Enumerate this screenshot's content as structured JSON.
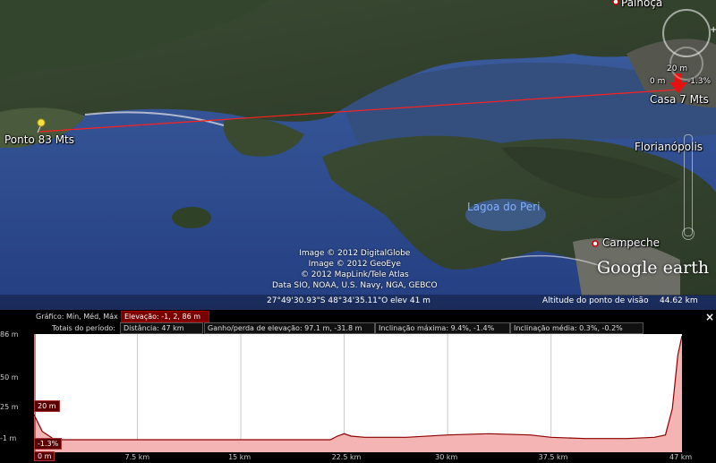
{
  "map": {
    "labels": {
      "palhoca": "Palhoça",
      "start_point": "Ponto 83 Mts",
      "end_point": "Casa 7 Mts",
      "florianopolis": "Florianópolis",
      "lagoa": "Lagoa do Peri",
      "campeche": "Campeche",
      "marker_elev": "20 m",
      "marker_left": "0 m",
      "marker_right": "-1.3%"
    },
    "credits": {
      "line1": "Image © 2012 DigitalGlobe",
      "line2": "Image © 2012 GeoEye",
      "line3": "© 2012 MapLink/Tele Atlas",
      "line4": "Data SIO, NOAA, U.S. Navy, NGA, GEBCO"
    },
    "logo": "Google earth",
    "status": {
      "coords": "27°49'30.93\"S   48°34'35.11\"O elev    41 m",
      "eye_alt_label": "Altitude do ponto de visão",
      "eye_alt_value": "44.62 km"
    }
  },
  "profile": {
    "graph_label": "Gráfico: Mín, Méd, Máx",
    "totals_label": "Totais do período:",
    "elevation": "Elevação: -1, 2, 86 m",
    "distance": "Distância: 47 km",
    "gain_loss": "Ganho/perda de elevação: 97.1 m, -31.8 m",
    "max_slope": "Inclinação máxima: 9.4%, -1.4%",
    "avg_slope": "Inclinação média: 0.3%, -0.2%",
    "close": "×",
    "cursor_elev": "20 m",
    "cursor_slope": "-1.3%",
    "cursor_dist": "0 m"
  },
  "chart_data": {
    "type": "area",
    "xlabel": "",
    "ylabel": "",
    "x_unit": "km",
    "y_unit": "m",
    "y_ticks": [
      "86 m",
      "50 m",
      "25 m",
      "-1 m"
    ],
    "x_ticks": [
      "7.5 km",
      "15 km",
      "22.5 km",
      "30 km",
      "37.5 km",
      "47 km"
    ],
    "ylim": [
      -1,
      86
    ],
    "xlim": [
      0,
      47
    ],
    "x": [
      0,
      0.6,
      1.5,
      5,
      10,
      15,
      20,
      21.5,
      22,
      22.5,
      23,
      24,
      27,
      30,
      33,
      36,
      37.5,
      40,
      43,
      45,
      45.8,
      46.3,
      46.7,
      47
    ],
    "y": [
      20,
      6,
      -1,
      -1,
      -1,
      -1,
      -1,
      -1,
      2,
      4,
      2,
      1,
      1,
      3,
      4,
      3,
      1,
      0,
      0,
      1,
      3,
      25,
      70,
      86
    ],
    "fill_color": "#f4b4b4",
    "line_color": "#8b0000"
  }
}
